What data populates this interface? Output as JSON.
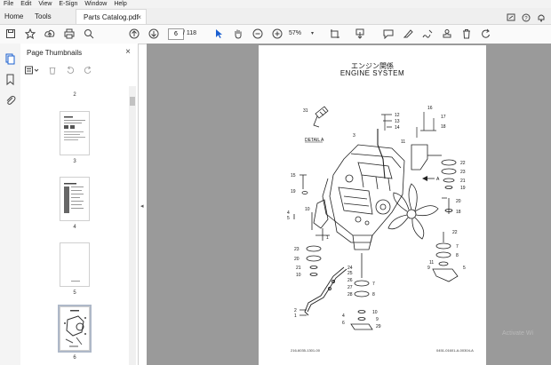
{
  "menu": {
    "items": [
      "File",
      "Edit",
      "View",
      "E-Sign",
      "Window",
      "Help"
    ]
  },
  "tabs": {
    "home": "Home",
    "tools": "Tools",
    "document": "Parts Catalog.pdf",
    "close": "×"
  },
  "toolbar": {
    "current_page": "6",
    "page_total": "/ 118",
    "zoom": "57%"
  },
  "panel": {
    "title": "Page Thumbnails",
    "close": "×",
    "thumbnails": [
      {
        "label": "2"
      },
      {
        "label": "3"
      },
      {
        "label": "4"
      },
      {
        "label": "5"
      },
      {
        "label": "6",
        "selected": true
      }
    ]
  },
  "document": {
    "title_jp": "エンジン関係",
    "title_en": "ENGINE SYSTEM",
    "detail_label": "DETAIL A",
    "arrow_label": "A",
    "callouts": [
      "31",
      "12",
      "13",
      "14",
      "3",
      "11",
      "16",
      "17",
      "18",
      "22",
      "23",
      "21",
      "19",
      "20",
      "18",
      "15",
      "19",
      "10",
      "1",
      "4",
      "5",
      "22",
      "23",
      "20",
      "21",
      "10",
      "9",
      "7",
      "8",
      "11",
      "5",
      "24",
      "25",
      "26",
      "27",
      "28",
      "29",
      "7",
      "8",
      "10",
      "2",
      "1",
      "4",
      "6",
      "9"
    ],
    "footer_left": "216-6035-1301-00",
    "footer_right": "0451-01601-A-00304-A"
  },
  "watermark": "Activate Wi"
}
